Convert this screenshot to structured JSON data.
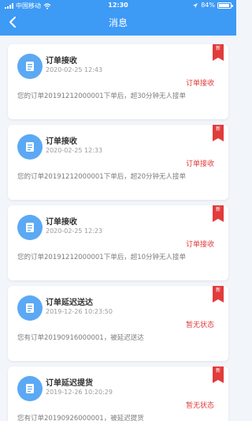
{
  "status_bar": {
    "carrier": "中国移动",
    "time": "12:30",
    "battery_percent": "84%"
  },
  "header": {
    "title": "消息"
  },
  "messages": [
    {
      "title": "订单接收",
      "time": "2020-02-25 12:43",
      "status": "订单接收",
      "desc": "您的订单20191212000001下单后，超30分钟无人接单",
      "badge": "新"
    },
    {
      "title": "订单接收",
      "time": "2020-02-25 12:33",
      "status": "订单接收",
      "desc": "您的订单20191212000001下单后，超20分钟无人接单",
      "badge": "新"
    },
    {
      "title": "订单接收",
      "time": "2020-02-25 12:23",
      "status": "订单接收",
      "desc": "您的订单20191212000001下单后，超10分钟无人接单",
      "badge": "新"
    },
    {
      "title": "订单延迟送达",
      "time": "2019-12-26 10:23:50",
      "status": "暂无状态",
      "desc": "您有订单20190916000001，被延迟送达",
      "badge": "新"
    },
    {
      "title": "订单延迟提货",
      "time": "2019-12-26 10:20:29",
      "status": "暂无状态",
      "desc": "您有订单20190926000001，被延迟提货",
      "badge": "新"
    }
  ],
  "colors": {
    "header_bg": "#3d9af5",
    "status_red": "#e23b3b",
    "avatar_blue": "#5ba9f4",
    "page_bg": "#f2f5fa"
  },
  "icons": {
    "back": "chevron-left-icon",
    "message": "message-note-icon",
    "wifi": "wifi-icon",
    "signal": "signal-icon",
    "battery": "battery-icon",
    "badge": "new-badge-icon"
  }
}
